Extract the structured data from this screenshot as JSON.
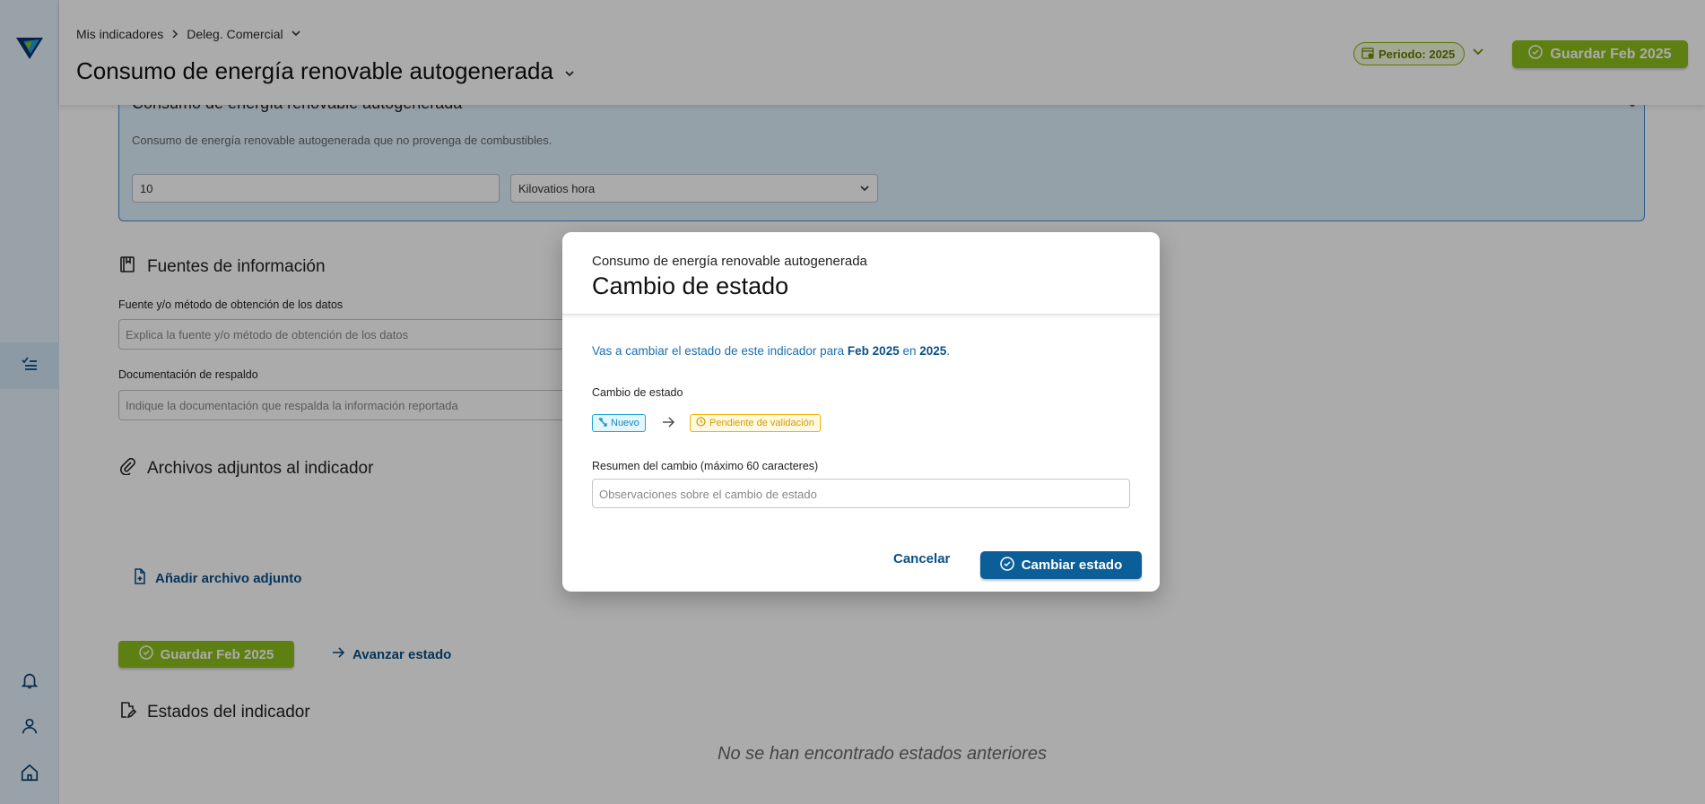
{
  "breadcrumb": {
    "root": "Mis indicadores",
    "current": "Deleg. Comercial"
  },
  "page": {
    "title": "Consumo de energía renovable autogenerada"
  },
  "header": {
    "period_label": "Periodo: 2025",
    "save_label": "Guardar Feb 2025"
  },
  "card": {
    "title": "Consumo de energía renovable autogenerada",
    "description": "Consumo de energía renovable autogenerada que no provenga de combustibles.",
    "value": "10",
    "unit": "Kilovatios hora"
  },
  "sources": {
    "title": "Fuentes de información",
    "method_label": "Fuente y/o método de obtención de los datos",
    "method_placeholder": "Explica la fuente y/o método de obtención de los datos",
    "docs_label": "Documentación de respaldo",
    "docs_placeholder": "Indique la documentación que respalda la información reportada"
  },
  "attachments": {
    "title": "Archivos adjuntos al indicador",
    "add_label": "Añadir archivo adjunto"
  },
  "actions": {
    "save_label": "Guardar Feb 2025",
    "advance_label": "Avanzar estado"
  },
  "states": {
    "title": "Estados del indicador",
    "empty": "No se han encontrado estados anteriores"
  },
  "modal": {
    "subtitle": "Consumo de energía renovable autogenerada",
    "title": "Cambio de estado",
    "info_prefix": "Vas a cambiar el estado de este indicador para ",
    "info_period": "Feb 2025",
    "info_mid": " en ",
    "info_year": "2025",
    "info_suffix": ".",
    "state_label": "Cambio de estado",
    "from_state": "Nuevo",
    "to_state": "Pendiente de validación",
    "summary_label": "Resumen del cambio (máximo 60 caracteres)",
    "summary_placeholder": "Observaciones sobre el cambio de estado",
    "cancel_label": "Cancelar",
    "confirm_label": "Cambiar estado"
  },
  "colors": {
    "accent_green": "#8cbe1a",
    "primary_blue": "#0b5e98",
    "sidebar_bg": "#e4f2fb"
  }
}
